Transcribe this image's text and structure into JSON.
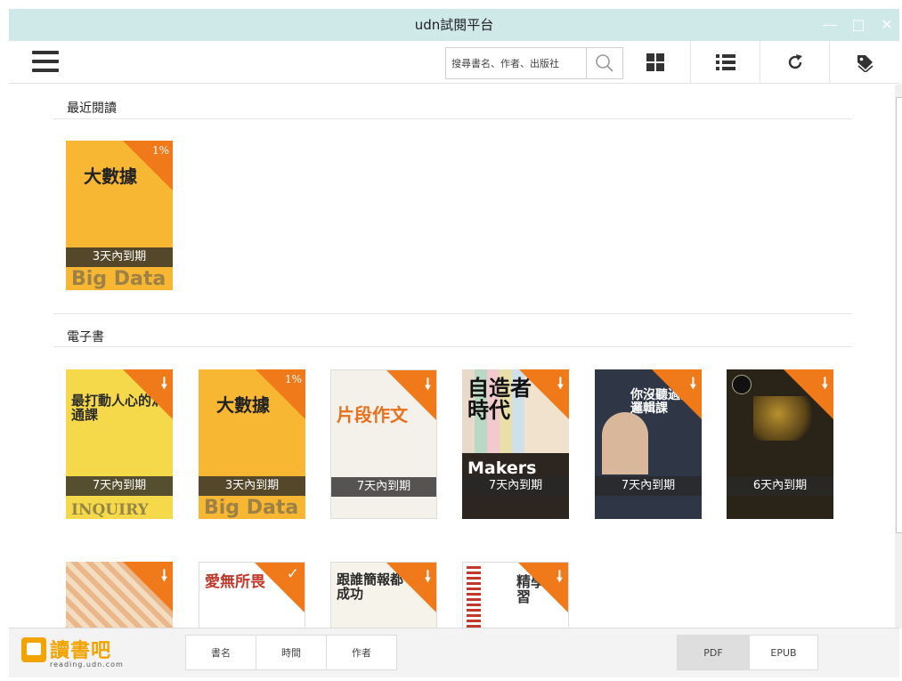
{
  "window": {
    "title": "udn試閱平台"
  },
  "toolbar": {
    "search_placeholder": "搜尋書名、作者、出版社"
  },
  "sections": {
    "recent": {
      "title": "最近閱讀"
    },
    "ebooks": {
      "title": "電子書"
    }
  },
  "recent_books": [
    {
      "title": "大數據",
      "progress": "1%",
      "expiry": "3天內到期",
      "subtitle": "Big Data"
    }
  ],
  "ebooks": [
    {
      "title": "最打動人心的溝通課",
      "expiry": "7天內到期",
      "subtitle": "INQUIRY"
    },
    {
      "title": "大數據",
      "progress": "1%",
      "expiry": "3天內到期",
      "subtitle": "Big Data"
    },
    {
      "title": "片段作文",
      "expiry": "7天內到期"
    },
    {
      "title": "自造者時代",
      "expiry": "7天內到期",
      "subtitle": "Makers"
    },
    {
      "title": "你沒聽過的邏輯課",
      "expiry": "7天內到期"
    },
    {
      "title": "",
      "expiry": "6天內到期"
    }
  ],
  "ebooks_row2": [
    {
      "title": ""
    },
    {
      "title": "愛無所畏"
    },
    {
      "title": "跟誰簡報都成功"
    },
    {
      "title": "精學習"
    }
  ],
  "bottombar": {
    "logo_text": "讀書吧",
    "logo_url": "reading.udn.com",
    "sort_title": "書名",
    "sort_time": "時間",
    "sort_author": "作者",
    "format_pdf": "PDF",
    "format_epub": "EPUB"
  },
  "colors": {
    "accent": "#f07a1a",
    "titlebar": "#cfe8e8",
    "logo": "#f2a300"
  }
}
